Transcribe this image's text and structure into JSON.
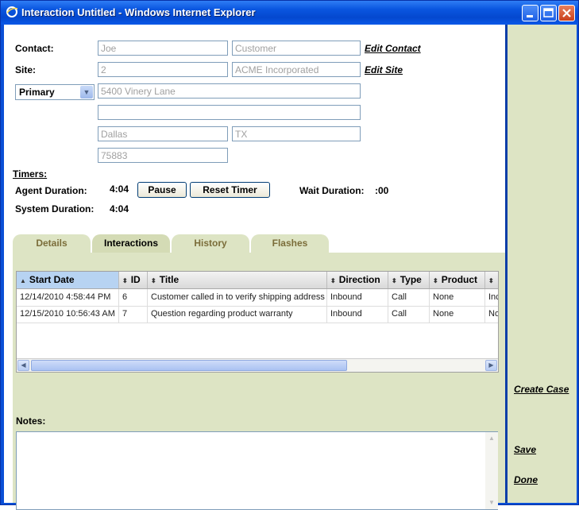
{
  "window": {
    "title": "Interaction Untitled - Windows Internet Explorer"
  },
  "contact": {
    "label": "Contact:",
    "first": "Joe",
    "last": "Customer",
    "edit_link": "Edit Contact"
  },
  "site": {
    "label": "Site:",
    "id": "2",
    "name": "ACME Incorporated",
    "edit_link": "Edit Site"
  },
  "address": {
    "type_selected": "Primary",
    "line1": "5400 Vinery Lane",
    "line2": "",
    "city": "Dallas",
    "state": "TX",
    "zip": "75883"
  },
  "timers": {
    "heading": "Timers:",
    "agent_label": "Agent Duration:",
    "agent_value": "4:04",
    "pause_button": "Pause",
    "reset_button": "Reset Timer",
    "wait_label": "Wait Duration:",
    "wait_value": ":00",
    "system_label": "System Duration:",
    "system_value": "4:04"
  },
  "tabs": [
    {
      "label": "Details",
      "active": false
    },
    {
      "label": "Interactions",
      "active": true
    },
    {
      "label": "History",
      "active": false
    },
    {
      "label": "Flashes",
      "active": false
    }
  ],
  "grid": {
    "columns": [
      "Start Date",
      "ID",
      "Title",
      "Direction",
      "Type",
      "Product",
      ""
    ],
    "rows": [
      [
        "12/14/2010 4:58:44 PM",
        "6",
        "Customer called in to verify shipping address",
        "Inbound",
        "Call",
        "None",
        "Inc"
      ],
      [
        "12/15/2010 10:56:43 AM",
        "7",
        "Question regarding product warranty",
        "Inbound",
        "Call",
        "None",
        "No"
      ]
    ]
  },
  "notes": {
    "label": "Notes:",
    "value": ""
  },
  "actions": {
    "create_case": "Create Case",
    "save": "Save",
    "done": "Done"
  }
}
